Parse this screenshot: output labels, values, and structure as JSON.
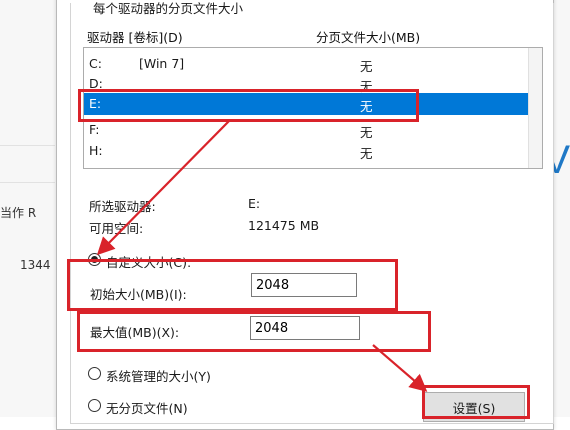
{
  "background": {
    "left_text": "当作 R",
    "left_number": "1344",
    "right_letter": "V"
  },
  "dialog": {
    "group_title": "每个驱动器的分页文件大小",
    "column_drive": "驱动器 [卷标](D)",
    "column_size": "分页文件大小(MB)",
    "drives": [
      {
        "letter": "C:",
        "label": "[Win 7]",
        "size": "无",
        "selected": false
      },
      {
        "letter": "D:",
        "label": "",
        "size": "无",
        "selected": false
      },
      {
        "letter": "E:",
        "label": "",
        "size": "无",
        "selected": true
      },
      {
        "letter": "F:",
        "label": "",
        "size": "无",
        "selected": false
      },
      {
        "letter": "H:",
        "label": "",
        "size": "无",
        "selected": false
      }
    ],
    "selected_drive_label": "所选驱动器:",
    "selected_drive_value": "E:",
    "available_space_label": "可用空间:",
    "available_space_value": "121475 MB",
    "custom_size_label": "自定义大小(C):",
    "initial_size_label": "初始大小(MB)(I):",
    "initial_size_value": "2048",
    "max_size_label": "最大值(MB)(X):",
    "max_size_value": "2048",
    "system_managed_label": "系统管理的大小(Y)",
    "no_paging_label": "无分页文件(N)",
    "set_button": "设置(S)"
  },
  "colors": {
    "selection": "#0078d7",
    "annotation": "#d9232a"
  }
}
